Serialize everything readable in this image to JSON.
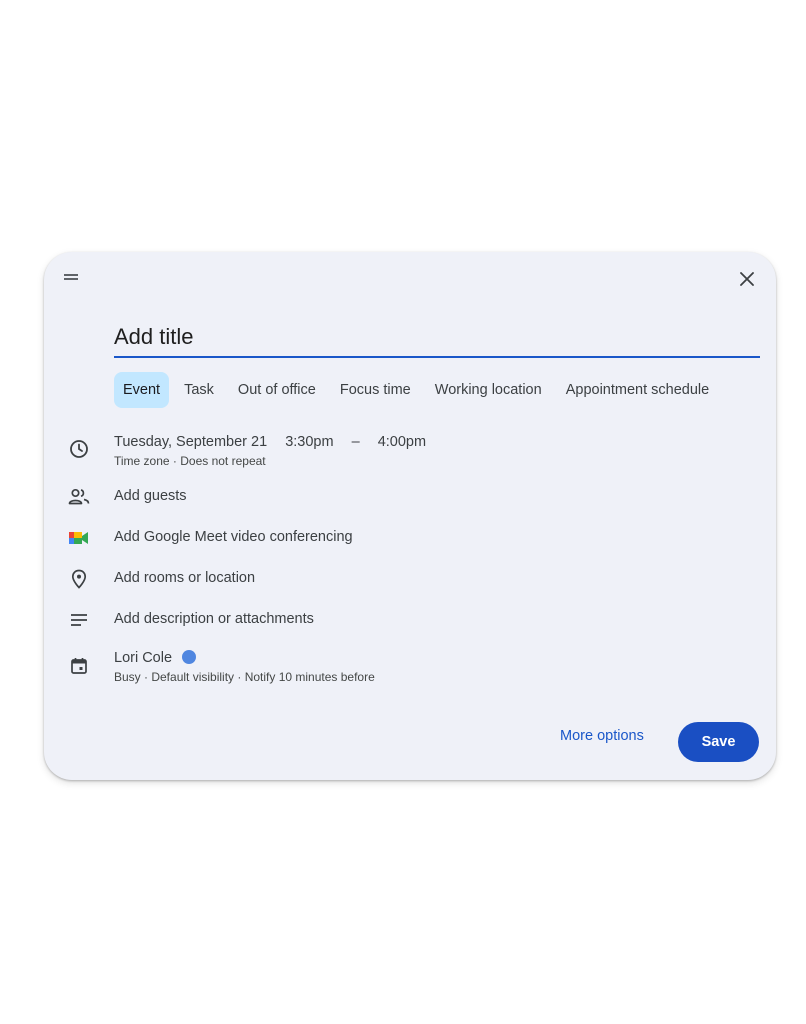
{
  "dialog": {
    "title_placeholder": "Add title",
    "tabs": [
      {
        "label": "Event",
        "active": true
      },
      {
        "label": "Task",
        "active": false
      },
      {
        "label": "Out of office",
        "active": false
      },
      {
        "label": "Focus time",
        "active": false
      },
      {
        "label": "Working location",
        "active": false
      },
      {
        "label": "Appointment schedule",
        "active": false
      }
    ],
    "datetime": {
      "date": "Tuesday, September 21",
      "start": "3:30pm",
      "separator": "–",
      "end": "4:00pm",
      "details": "Time zone · Does not repeat"
    },
    "guests_label": "Add guests",
    "meet_label": "Add Google Meet video conferencing",
    "location_label": "Add rooms or location",
    "description_label": "Add description or attachments",
    "calendar": {
      "owner": "Lori Cole",
      "color": "#4f86e0",
      "details": "Busy · Default visibility · Notify 10 minutes before"
    },
    "more_options_label": "More options",
    "save_label": "Save"
  },
  "colors": {
    "accent": "#1a57c9",
    "save_button": "#1a4fc3",
    "active_tab": "#c2e7ff",
    "dialog_bg": "#eff1f8"
  },
  "icons": [
    "drag-handle-icon",
    "close-icon",
    "clock-icon",
    "people-icon",
    "google-meet-icon",
    "location-pin-icon",
    "notes-icon",
    "calendar-icon"
  ]
}
